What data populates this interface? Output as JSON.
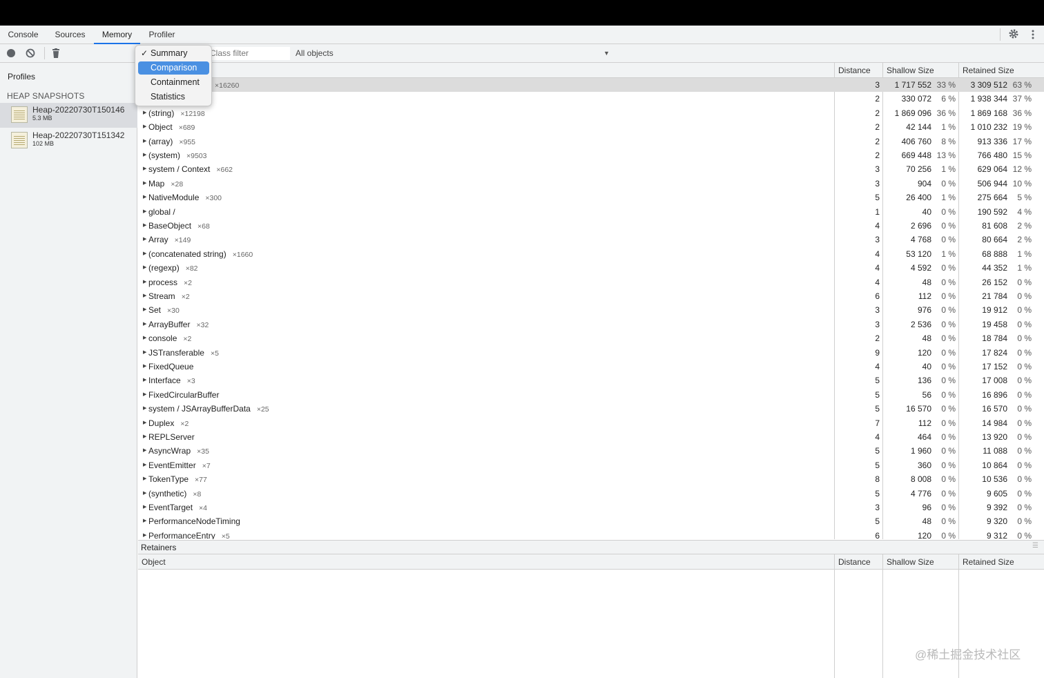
{
  "tabs": [
    "Console",
    "Sources",
    "Memory",
    "Profiler"
  ],
  "toolbar": {
    "filter_placeholder": "Class filter",
    "object_select": "All objects"
  },
  "view_menu": {
    "items": [
      "Summary",
      "Comparison",
      "Containment",
      "Statistics"
    ],
    "checked": "Summary",
    "highlighted": "Comparison"
  },
  "sidebar": {
    "title": "Profiles",
    "section": "HEAP SNAPSHOTS",
    "snapshots": [
      {
        "name": "Heap-20220730T150146",
        "size": "5.3 MB"
      },
      {
        "name": "Heap-20220730T151342",
        "size": "102 MB"
      }
    ]
  },
  "columns": {
    "constructor": "",
    "distance": "Distance",
    "shallow": "Shallow Size",
    "retained": "Retained Size"
  },
  "rows": [
    {
      "name": "",
      "count": "×16260",
      "distance": "3",
      "shallow": "1 717 552",
      "shallow_pct": "33 %",
      "retained": "3 309 512",
      "retained_pct": "63 %"
    },
    {
      "name": "",
      "count": "",
      "distance": "2",
      "shallow": "330 072",
      "shallow_pct": "6 %",
      "retained": "1 938 344",
      "retained_pct": "37 %"
    },
    {
      "name": "(string)",
      "count": "×12198",
      "distance": "2",
      "shallow": "1 869 096",
      "shallow_pct": "36 %",
      "retained": "1 869 168",
      "retained_pct": "36 %"
    },
    {
      "name": "Object",
      "count": "×689",
      "distance": "2",
      "shallow": "42 144",
      "shallow_pct": "1 %",
      "retained": "1 010 232",
      "retained_pct": "19 %"
    },
    {
      "name": "(array)",
      "count": "×955",
      "distance": "2",
      "shallow": "406 760",
      "shallow_pct": "8 %",
      "retained": "913 336",
      "retained_pct": "17 %"
    },
    {
      "name": "(system)",
      "count": "×9503",
      "distance": "2",
      "shallow": "669 448",
      "shallow_pct": "13 %",
      "retained": "766 480",
      "retained_pct": "15 %"
    },
    {
      "name": "system / Context",
      "count": "×662",
      "distance": "3",
      "shallow": "70 256",
      "shallow_pct": "1 %",
      "retained": "629 064",
      "retained_pct": "12 %"
    },
    {
      "name": "Map",
      "count": "×28",
      "distance": "3",
      "shallow": "904",
      "shallow_pct": "0 %",
      "retained": "506 944",
      "retained_pct": "10 %"
    },
    {
      "name": "NativeModule",
      "count": "×300",
      "distance": "5",
      "shallow": "26 400",
      "shallow_pct": "1 %",
      "retained": "275 664",
      "retained_pct": "5 %"
    },
    {
      "name": "global /",
      "count": "",
      "distance": "1",
      "shallow": "40",
      "shallow_pct": "0 %",
      "retained": "190 592",
      "retained_pct": "4 %"
    },
    {
      "name": "BaseObject",
      "count": "×68",
      "distance": "4",
      "shallow": "2 696",
      "shallow_pct": "0 %",
      "retained": "81 608",
      "retained_pct": "2 %"
    },
    {
      "name": "Array",
      "count": "×149",
      "distance": "3",
      "shallow": "4 768",
      "shallow_pct": "0 %",
      "retained": "80 664",
      "retained_pct": "2 %"
    },
    {
      "name": "(concatenated string)",
      "count": "×1660",
      "distance": "4",
      "shallow": "53 120",
      "shallow_pct": "1 %",
      "retained": "68 888",
      "retained_pct": "1 %"
    },
    {
      "name": "(regexp)",
      "count": "×82",
      "distance": "4",
      "shallow": "4 592",
      "shallow_pct": "0 %",
      "retained": "44 352",
      "retained_pct": "1 %"
    },
    {
      "name": "process",
      "count": "×2",
      "distance": "4",
      "shallow": "48",
      "shallow_pct": "0 %",
      "retained": "26 152",
      "retained_pct": "0 %"
    },
    {
      "name": "Stream",
      "count": "×2",
      "distance": "6",
      "shallow": "112",
      "shallow_pct": "0 %",
      "retained": "21 784",
      "retained_pct": "0 %"
    },
    {
      "name": "Set",
      "count": "×30",
      "distance": "3",
      "shallow": "976",
      "shallow_pct": "0 %",
      "retained": "19 912",
      "retained_pct": "0 %"
    },
    {
      "name": "ArrayBuffer",
      "count": "×32",
      "distance": "3",
      "shallow": "2 536",
      "shallow_pct": "0 %",
      "retained": "19 458",
      "retained_pct": "0 %"
    },
    {
      "name": "console",
      "count": "×2",
      "distance": "2",
      "shallow": "48",
      "shallow_pct": "0 %",
      "retained": "18 784",
      "retained_pct": "0 %"
    },
    {
      "name": "JSTransferable",
      "count": "×5",
      "distance": "9",
      "shallow": "120",
      "shallow_pct": "0 %",
      "retained": "17 824",
      "retained_pct": "0 %"
    },
    {
      "name": "FixedQueue",
      "count": "",
      "distance": "4",
      "shallow": "40",
      "shallow_pct": "0 %",
      "retained": "17 152",
      "retained_pct": "0 %"
    },
    {
      "name": "Interface",
      "count": "×3",
      "distance": "5",
      "shallow": "136",
      "shallow_pct": "0 %",
      "retained": "17 008",
      "retained_pct": "0 %"
    },
    {
      "name": "FixedCircularBuffer",
      "count": "",
      "distance": "5",
      "shallow": "56",
      "shallow_pct": "0 %",
      "retained": "16 896",
      "retained_pct": "0 %"
    },
    {
      "name": "system / JSArrayBufferData",
      "count": "×25",
      "distance": "5",
      "shallow": "16 570",
      "shallow_pct": "0 %",
      "retained": "16 570",
      "retained_pct": "0 %"
    },
    {
      "name": "Duplex",
      "count": "×2",
      "distance": "7",
      "shallow": "112",
      "shallow_pct": "0 %",
      "retained": "14 984",
      "retained_pct": "0 %"
    },
    {
      "name": "REPLServer",
      "count": "",
      "distance": "4",
      "shallow": "464",
      "shallow_pct": "0 %",
      "retained": "13 920",
      "retained_pct": "0 %"
    },
    {
      "name": "AsyncWrap",
      "count": "×35",
      "distance": "5",
      "shallow": "1 960",
      "shallow_pct": "0 %",
      "retained": "11 088",
      "retained_pct": "0 %"
    },
    {
      "name": "EventEmitter",
      "count": "×7",
      "distance": "5",
      "shallow": "360",
      "shallow_pct": "0 %",
      "retained": "10 864",
      "retained_pct": "0 %"
    },
    {
      "name": "TokenType",
      "count": "×77",
      "distance": "8",
      "shallow": "8 008",
      "shallow_pct": "0 %",
      "retained": "10 536",
      "retained_pct": "0 %"
    },
    {
      "name": "(synthetic)",
      "count": "×8",
      "distance": "5",
      "shallow": "4 776",
      "shallow_pct": "0 %",
      "retained": "9 605",
      "retained_pct": "0 %"
    },
    {
      "name": "EventTarget",
      "count": "×4",
      "distance": "3",
      "shallow": "96",
      "shallow_pct": "0 %",
      "retained": "9 392",
      "retained_pct": "0 %"
    },
    {
      "name": "PerformanceNodeTiming",
      "count": "",
      "distance": "5",
      "shallow": "48",
      "shallow_pct": "0 %",
      "retained": "9 320",
      "retained_pct": "0 %"
    },
    {
      "name": "PerformanceEntry",
      "count": "×5",
      "distance": "6",
      "shallow": "120",
      "shallow_pct": "0 %",
      "retained": "9 312",
      "retained_pct": "0 %"
    }
  ],
  "retainers": {
    "title": "Retainers",
    "columns": {
      "object": "Object",
      "distance": "Distance",
      "shallow": "Shallow Size",
      "retained": "Retained Size"
    }
  },
  "watermark": "@稀土掘金技术社区"
}
